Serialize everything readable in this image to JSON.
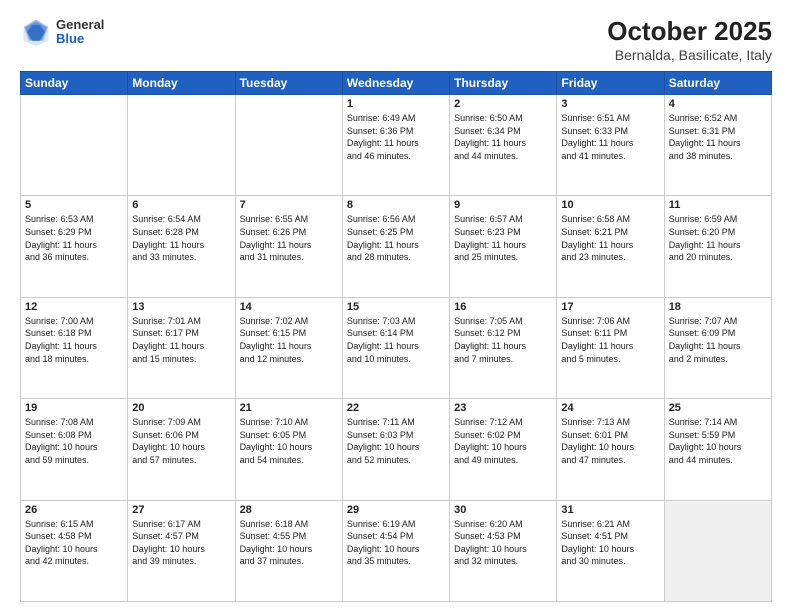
{
  "header": {
    "logo_general": "General",
    "logo_blue": "Blue",
    "title": "October 2025",
    "subtitle": "Bernalda, Basilicate, Italy"
  },
  "weekdays": [
    "Sunday",
    "Monday",
    "Tuesday",
    "Wednesday",
    "Thursday",
    "Friday",
    "Saturday"
  ],
  "weeks": [
    [
      {
        "day": "",
        "info": ""
      },
      {
        "day": "",
        "info": ""
      },
      {
        "day": "",
        "info": ""
      },
      {
        "day": "1",
        "info": "Sunrise: 6:49 AM\nSunset: 6:36 PM\nDaylight: 11 hours\nand 46 minutes."
      },
      {
        "day": "2",
        "info": "Sunrise: 6:50 AM\nSunset: 6:34 PM\nDaylight: 11 hours\nand 44 minutes."
      },
      {
        "day": "3",
        "info": "Sunrise: 6:51 AM\nSunset: 6:33 PM\nDaylight: 11 hours\nand 41 minutes."
      },
      {
        "day": "4",
        "info": "Sunrise: 6:52 AM\nSunset: 6:31 PM\nDaylight: 11 hours\nand 38 minutes."
      }
    ],
    [
      {
        "day": "5",
        "info": "Sunrise: 6:53 AM\nSunset: 6:29 PM\nDaylight: 11 hours\nand 36 minutes."
      },
      {
        "day": "6",
        "info": "Sunrise: 6:54 AM\nSunset: 6:28 PM\nDaylight: 11 hours\nand 33 minutes."
      },
      {
        "day": "7",
        "info": "Sunrise: 6:55 AM\nSunset: 6:26 PM\nDaylight: 11 hours\nand 31 minutes."
      },
      {
        "day": "8",
        "info": "Sunrise: 6:56 AM\nSunset: 6:25 PM\nDaylight: 11 hours\nand 28 minutes."
      },
      {
        "day": "9",
        "info": "Sunrise: 6:57 AM\nSunset: 6:23 PM\nDaylight: 11 hours\nand 25 minutes."
      },
      {
        "day": "10",
        "info": "Sunrise: 6:58 AM\nSunset: 6:21 PM\nDaylight: 11 hours\nand 23 minutes."
      },
      {
        "day": "11",
        "info": "Sunrise: 6:59 AM\nSunset: 6:20 PM\nDaylight: 11 hours\nand 20 minutes."
      }
    ],
    [
      {
        "day": "12",
        "info": "Sunrise: 7:00 AM\nSunset: 6:18 PM\nDaylight: 11 hours\nand 18 minutes."
      },
      {
        "day": "13",
        "info": "Sunrise: 7:01 AM\nSunset: 6:17 PM\nDaylight: 11 hours\nand 15 minutes."
      },
      {
        "day": "14",
        "info": "Sunrise: 7:02 AM\nSunset: 6:15 PM\nDaylight: 11 hours\nand 12 minutes."
      },
      {
        "day": "15",
        "info": "Sunrise: 7:03 AM\nSunset: 6:14 PM\nDaylight: 11 hours\nand 10 minutes."
      },
      {
        "day": "16",
        "info": "Sunrise: 7:05 AM\nSunset: 6:12 PM\nDaylight: 11 hours\nand 7 minutes."
      },
      {
        "day": "17",
        "info": "Sunrise: 7:06 AM\nSunset: 6:11 PM\nDaylight: 11 hours\nand 5 minutes."
      },
      {
        "day": "18",
        "info": "Sunrise: 7:07 AM\nSunset: 6:09 PM\nDaylight: 11 hours\nand 2 minutes."
      }
    ],
    [
      {
        "day": "19",
        "info": "Sunrise: 7:08 AM\nSunset: 6:08 PM\nDaylight: 10 hours\nand 59 minutes."
      },
      {
        "day": "20",
        "info": "Sunrise: 7:09 AM\nSunset: 6:06 PM\nDaylight: 10 hours\nand 57 minutes."
      },
      {
        "day": "21",
        "info": "Sunrise: 7:10 AM\nSunset: 6:05 PM\nDaylight: 10 hours\nand 54 minutes."
      },
      {
        "day": "22",
        "info": "Sunrise: 7:11 AM\nSunset: 6:03 PM\nDaylight: 10 hours\nand 52 minutes."
      },
      {
        "day": "23",
        "info": "Sunrise: 7:12 AM\nSunset: 6:02 PM\nDaylight: 10 hours\nand 49 minutes."
      },
      {
        "day": "24",
        "info": "Sunrise: 7:13 AM\nSunset: 6:01 PM\nDaylight: 10 hours\nand 47 minutes."
      },
      {
        "day": "25",
        "info": "Sunrise: 7:14 AM\nSunset: 5:59 PM\nDaylight: 10 hours\nand 44 minutes."
      }
    ],
    [
      {
        "day": "26",
        "info": "Sunrise: 6:15 AM\nSunset: 4:58 PM\nDaylight: 10 hours\nand 42 minutes."
      },
      {
        "day": "27",
        "info": "Sunrise: 6:17 AM\nSunset: 4:57 PM\nDaylight: 10 hours\nand 39 minutes."
      },
      {
        "day": "28",
        "info": "Sunrise: 6:18 AM\nSunset: 4:55 PM\nDaylight: 10 hours\nand 37 minutes."
      },
      {
        "day": "29",
        "info": "Sunrise: 6:19 AM\nSunset: 4:54 PM\nDaylight: 10 hours\nand 35 minutes."
      },
      {
        "day": "30",
        "info": "Sunrise: 6:20 AM\nSunset: 4:53 PM\nDaylight: 10 hours\nand 32 minutes."
      },
      {
        "day": "31",
        "info": "Sunrise: 6:21 AM\nSunset: 4:51 PM\nDaylight: 10 hours\nand 30 minutes."
      },
      {
        "day": "",
        "info": ""
      }
    ]
  ]
}
